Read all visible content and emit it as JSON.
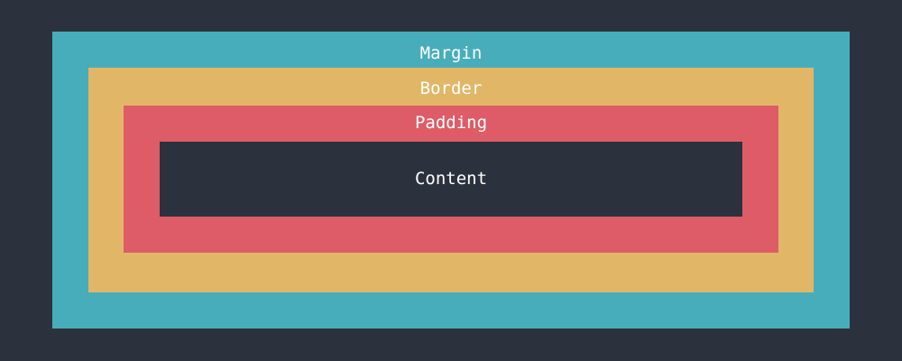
{
  "diagram": {
    "layers": {
      "margin": {
        "label": "Margin",
        "color": "#47adbb"
      },
      "border": {
        "label": "Border",
        "color": "#e1b767"
      },
      "padding": {
        "label": "Padding",
        "color": "#dd5c67"
      },
      "content": {
        "label": "Content",
        "color": "#2c323d"
      }
    },
    "background_color": "#2c323d",
    "label_color": "#ffffff"
  }
}
